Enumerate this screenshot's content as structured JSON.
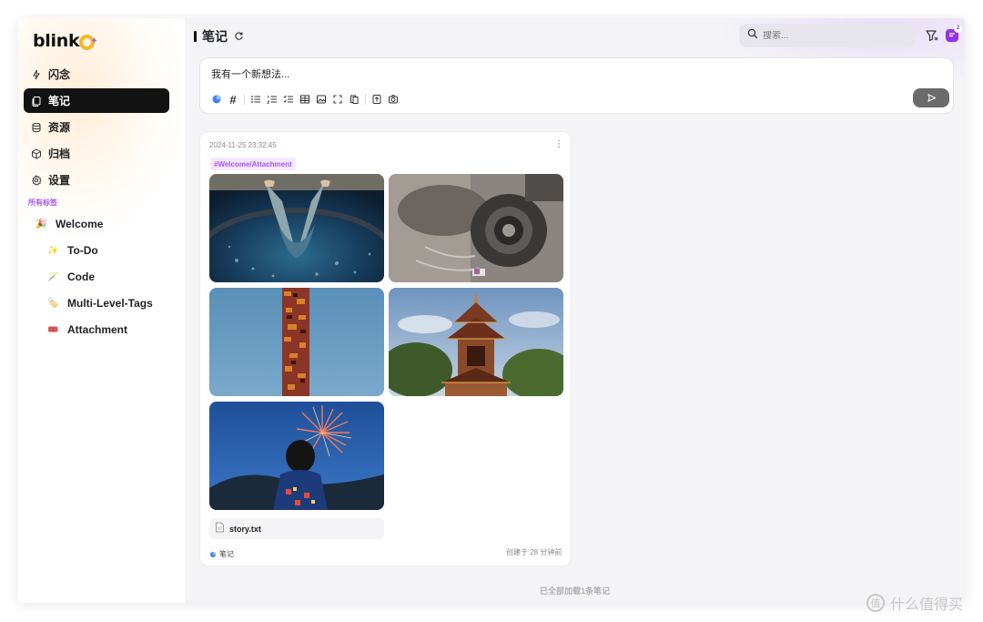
{
  "app": {
    "logo_text": "blink"
  },
  "sidebar": {
    "items": [
      {
        "label": "闪念",
        "icon": "lightning-icon"
      },
      {
        "label": "笔记",
        "icon": "notes-icon",
        "active": true
      },
      {
        "label": "资源",
        "icon": "database-icon"
      },
      {
        "label": "归档",
        "icon": "archive-box-icon"
      },
      {
        "label": "设置",
        "icon": "gear-icon"
      }
    ],
    "tags_heading": "所有标签",
    "tags": [
      {
        "label": "Welcome",
        "icon": "party-popper-icon",
        "level": 0
      },
      {
        "label": "To-Do",
        "icon": "sparkles-icon",
        "level": 1
      },
      {
        "label": "Code",
        "icon": "magic-wand-icon",
        "level": 1
      },
      {
        "label": "Multi-Level-Tags",
        "icon": "label-tag-icon",
        "level": 1
      },
      {
        "label": "Attachment",
        "icon": "ticket-icon",
        "level": 1
      }
    ]
  },
  "header": {
    "title": "笔记",
    "search_placeholder": "搜索...",
    "chat_badge": "2"
  },
  "editor": {
    "placeholder": "我有一个新想法..."
  },
  "note": {
    "timestamp": "2024-11-25 23:32:45",
    "tag": "#Welcome/Attachment",
    "attachment_name": "story.txt",
    "footer_tag": "笔记",
    "created": "创建于 28 分钟前"
  },
  "footer": {
    "load_all": "已全部加载1条笔记"
  },
  "watermark": "什么值得买",
  "colors": {
    "accent": "#a855f7",
    "active_nav": "#121212",
    "logo_ring": "#f5b82c"
  }
}
